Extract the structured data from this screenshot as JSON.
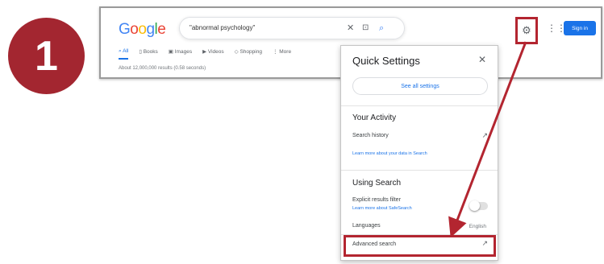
{
  "step": {
    "number": "1"
  },
  "google": {
    "logo_letters": [
      {
        "char": "G",
        "color": "#4285f4"
      },
      {
        "char": "o",
        "color": "#ea4335"
      },
      {
        "char": "o",
        "color": "#fbbc05"
      },
      {
        "char": "g",
        "color": "#4285f4"
      },
      {
        "char": "l",
        "color": "#34a853"
      },
      {
        "char": "e",
        "color": "#ea4335"
      }
    ],
    "search_query": "\"abnormal psychology\"",
    "tabs": [
      {
        "label": "All",
        "icon": "search-icon",
        "active": true
      },
      {
        "label": "Books",
        "icon": "book-icon",
        "active": false
      },
      {
        "label": "Images",
        "icon": "image-icon",
        "active": false
      },
      {
        "label": "Videos",
        "icon": "video-icon",
        "active": false
      },
      {
        "label": "Shopping",
        "icon": "tag-icon",
        "active": false
      },
      {
        "label": "More",
        "icon": "more-icon",
        "active": false
      }
    ],
    "results_stats": "About 12,000,000 results (0.58 seconds)",
    "signin_label": "Sign in"
  },
  "quick_settings": {
    "title": "Quick Settings",
    "see_all": "See all settings",
    "your_activity": {
      "heading": "Your Activity",
      "search_history": "Search history",
      "learn_more": "Learn more about your data in Search"
    },
    "using_search": {
      "heading": "Using Search",
      "explicit_filter": "Explicit results filter",
      "safesearch_link": "Learn more about SafeSearch",
      "languages_label": "Languages",
      "languages_value": "English",
      "advanced_search": "Advanced search"
    }
  },
  "colors": {
    "highlight": "#b32530",
    "badge": "#a32630",
    "link": "#1a73e8"
  }
}
